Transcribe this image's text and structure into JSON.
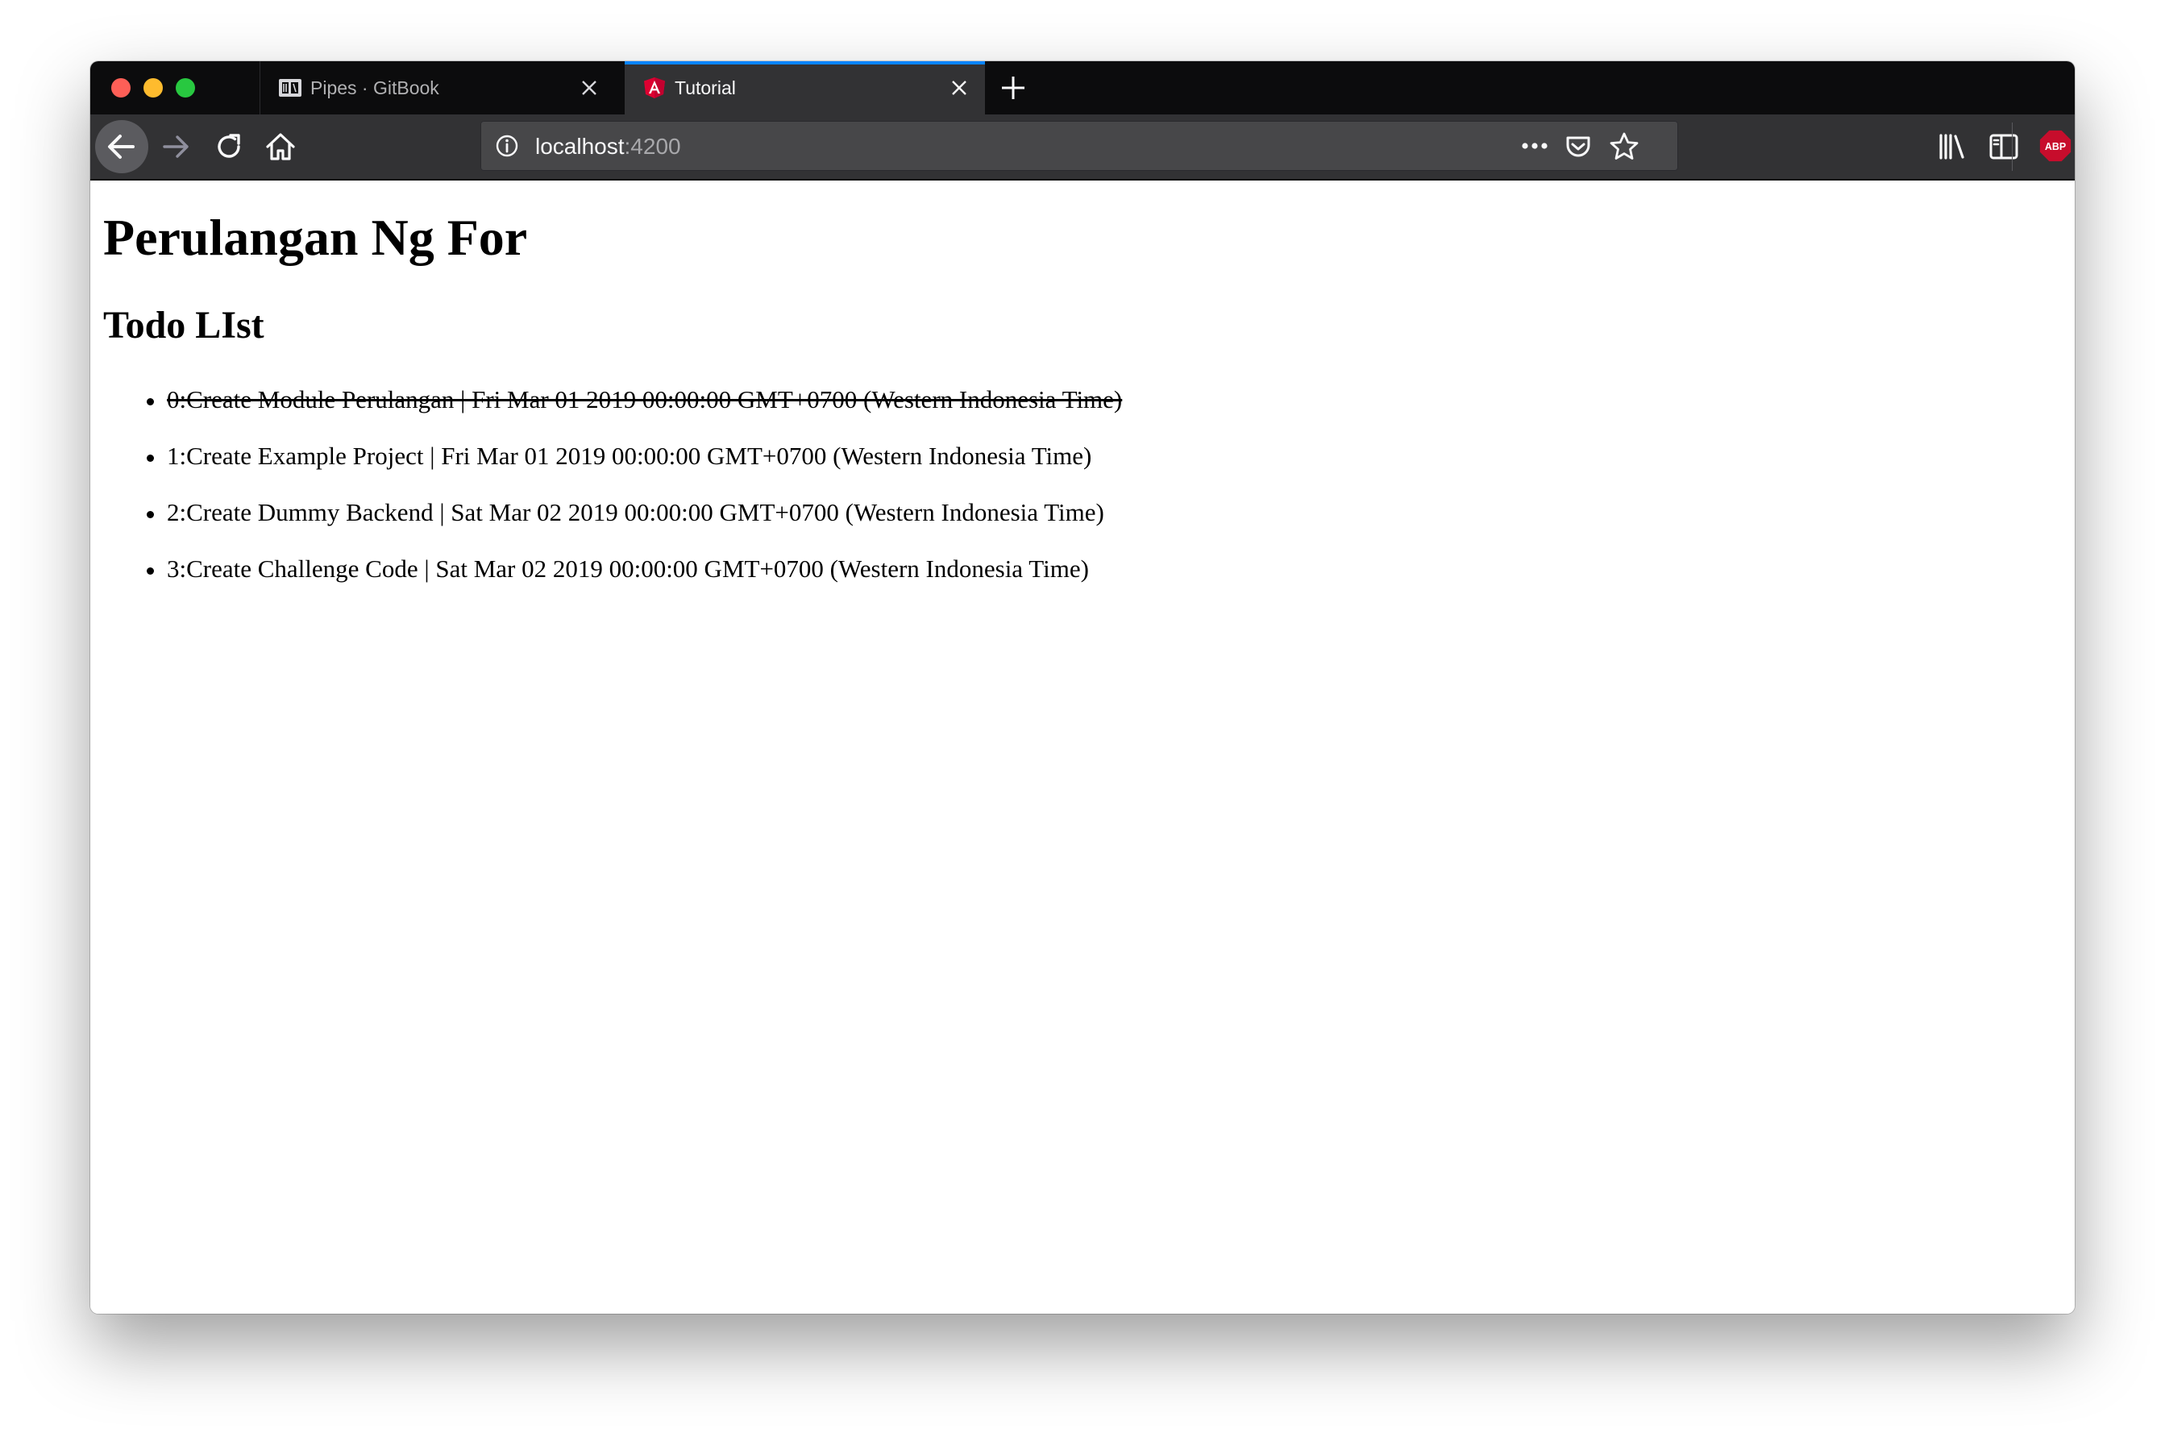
{
  "browser": {
    "tabs": [
      {
        "title": "Pipes · GitBook",
        "icon": "gitbook-icon",
        "active": false
      },
      {
        "title": "Tutorial",
        "icon": "angular-icon",
        "active": true
      }
    ],
    "url": {
      "host": "localhost",
      "port": ":4200"
    },
    "accent_color": "#0a84ff",
    "toolbar_icons": [
      "back-icon",
      "forward-icon",
      "reload-icon",
      "home-icon",
      "info-icon",
      "more-icon",
      "pocket-icon",
      "bookmark-star-icon",
      "library-icon",
      "sidebar-icon",
      "adblock-plus-icon",
      "menu-icon"
    ],
    "adblock_label": "ABP"
  },
  "page": {
    "title": "Perulangan Ng For",
    "subtitle": "Todo LIst",
    "todos": [
      {
        "text": "0:Create Module Perulangan | Fri Mar 01 2019 00:00:00 GMT+0700 (Western Indonesia Time)",
        "done": true
      },
      {
        "text": "1:Create Example Project | Fri Mar 01 2019 00:00:00 GMT+0700 (Western Indonesia Time)",
        "done": false
      },
      {
        "text": "2:Create Dummy Backend | Sat Mar 02 2019 00:00:00 GMT+0700 (Western Indonesia Time)",
        "done": false
      },
      {
        "text": "3:Create Challenge Code | Sat Mar 02 2019 00:00:00 GMT+0700 (Western Indonesia Time)",
        "done": false
      }
    ]
  }
}
